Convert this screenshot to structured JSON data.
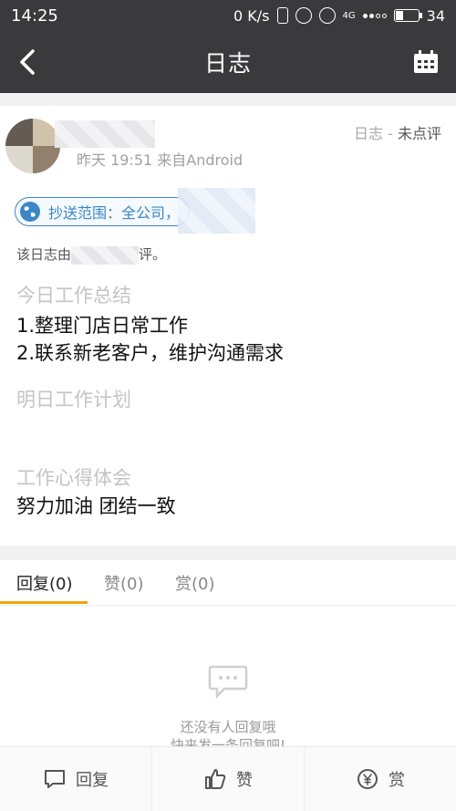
{
  "status_bar": {
    "time": "14:25",
    "net_speed": "0 K/s",
    "network": "4G",
    "battery": "34"
  },
  "header": {
    "title": "日志"
  },
  "post": {
    "meta": "昨天 19:51 来自Android",
    "tag_type": "日志",
    "tag_separator": " - ",
    "tag_status": "未点评",
    "cc_text": "抄送范围：全公司，",
    "review_prefix": "该日志由",
    "review_suffix": "评。",
    "sections": [
      {
        "heading": "今日工作总结",
        "lines": [
          "1.整理门店日常工作",
          "2.联系新老客户，维护沟通需求"
        ]
      },
      {
        "heading": "明日工作计划",
        "lines": []
      },
      {
        "heading": "工作心得体会",
        "lines": [
          "努力加油 团结一致"
        ]
      }
    ]
  },
  "tabs": [
    {
      "label": "回复(0)"
    },
    {
      "label": "赞(0)"
    },
    {
      "label": "赏(0)"
    }
  ],
  "empty_state": {
    "line1": "还没有人回复哦",
    "line2": "快来发一条回复吧!"
  },
  "bottom_bar": {
    "reply": "回复",
    "like": "赞",
    "reward": "赏"
  },
  "colors": {
    "header_bg": "#3a3a3c",
    "accent": "#f0a30a",
    "link_blue": "#3c86c8"
  }
}
